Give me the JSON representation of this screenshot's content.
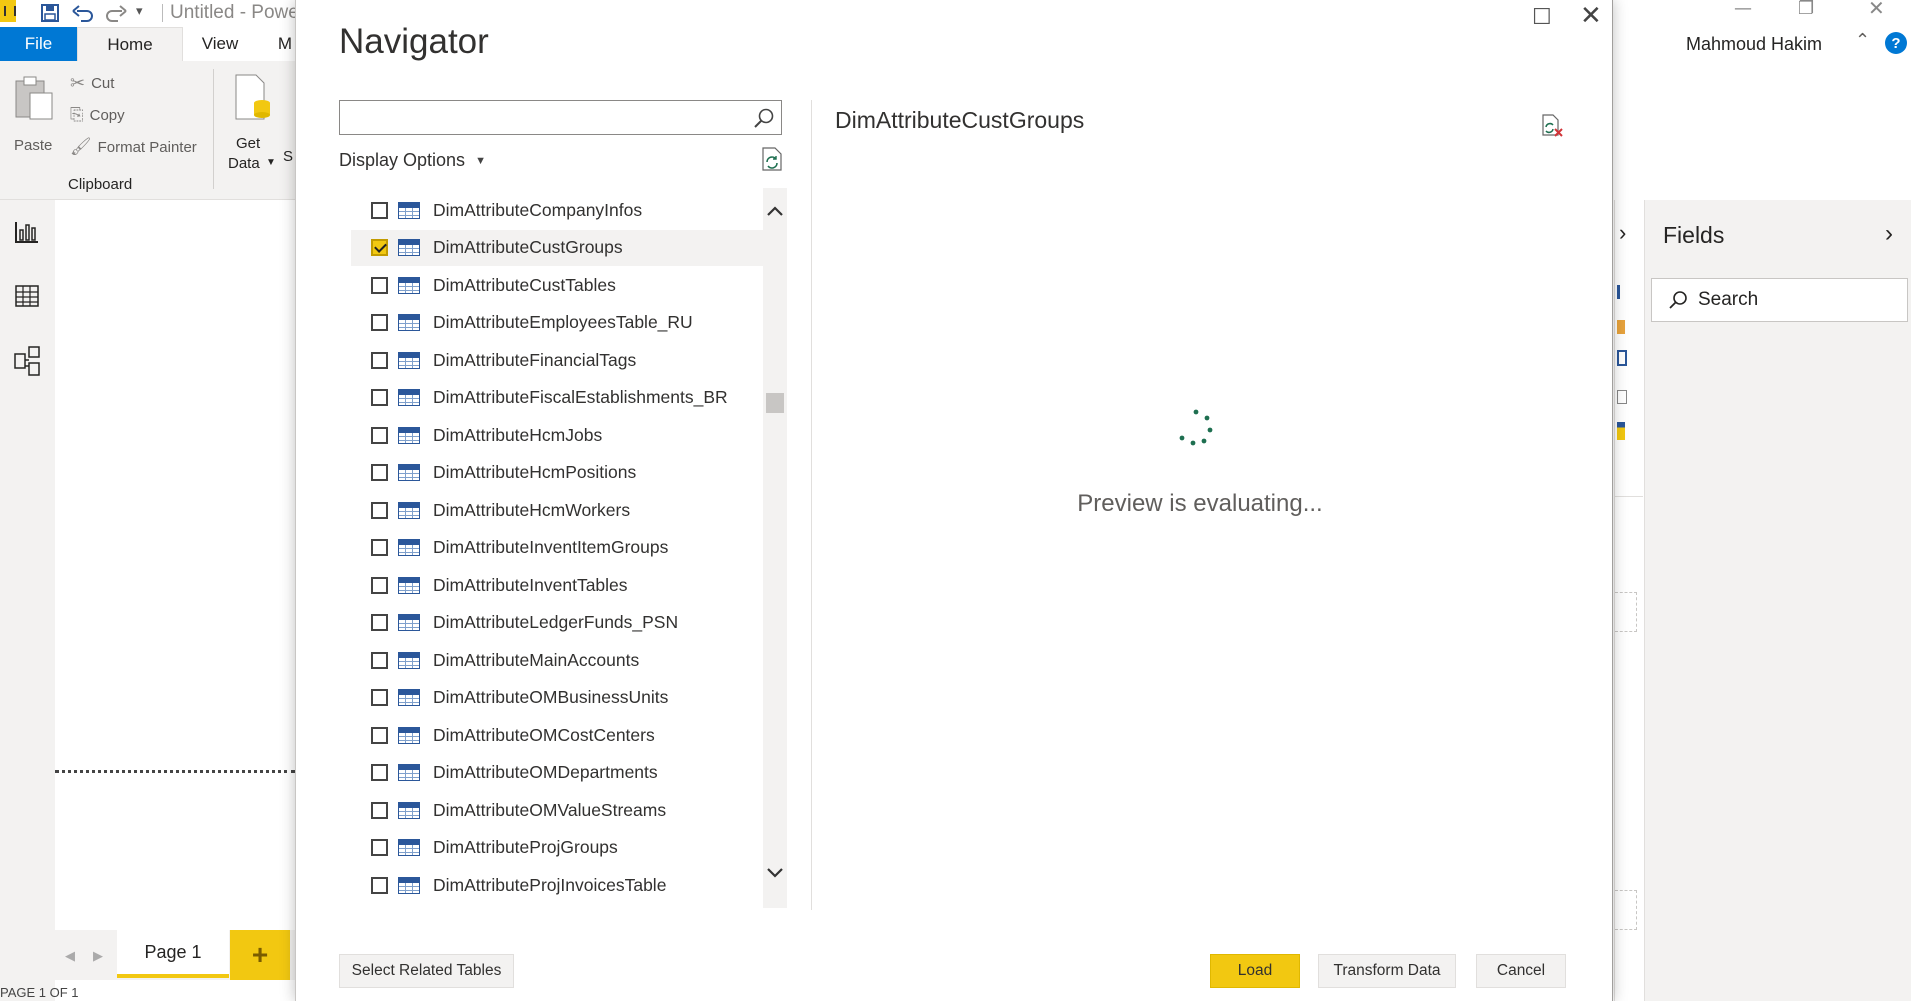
{
  "window": {
    "title": "Untitled - Powe",
    "user_name": "Mahmoud Hakim",
    "help_glyph": "?"
  },
  "ribbon": {
    "tabs": [
      {
        "label": "File"
      },
      {
        "label": "Home"
      },
      {
        "label": "View"
      },
      {
        "label": "M"
      }
    ],
    "clipboard": {
      "paste_label": "Paste",
      "cut_label": "Cut",
      "copy_label": "Copy",
      "format_painter_label": "Format Painter",
      "group_label": "Clipboard"
    },
    "get_data": {
      "line1": "Get",
      "line2": "Data",
      "overflow": "S"
    }
  },
  "pages": {
    "current_page_label": "Page 1",
    "add_glyph": "+",
    "status_text": "PAGE 1 OF 1"
  },
  "fields_pane": {
    "title": "Fields",
    "search_placeholder": "Search"
  },
  "navigator": {
    "title": "Navigator",
    "search_value": "",
    "display_options_label": "Display Options",
    "items": [
      {
        "label": "DimAttributeCompanyInfos",
        "checked": false
      },
      {
        "label": "DimAttributeCustGroups",
        "checked": true
      },
      {
        "label": "DimAttributeCustTables",
        "checked": false
      },
      {
        "label": "DimAttributeEmployeesTable_RU",
        "checked": false
      },
      {
        "label": "DimAttributeFinancialTags",
        "checked": false
      },
      {
        "label": "DimAttributeFiscalEstablishments_BR",
        "checked": false
      },
      {
        "label": "DimAttributeHcmJobs",
        "checked": false
      },
      {
        "label": "DimAttributeHcmPositions",
        "checked": false
      },
      {
        "label": "DimAttributeHcmWorkers",
        "checked": false
      },
      {
        "label": "DimAttributeInventItemGroups",
        "checked": false
      },
      {
        "label": "DimAttributeInventTables",
        "checked": false
      },
      {
        "label": "DimAttributeLedgerFunds_PSN",
        "checked": false
      },
      {
        "label": "DimAttributeMainAccounts",
        "checked": false
      },
      {
        "label": "DimAttributeOMBusinessUnits",
        "checked": false
      },
      {
        "label": "DimAttributeOMCostCenters",
        "checked": false
      },
      {
        "label": "DimAttributeOMDepartments",
        "checked": false
      },
      {
        "label": "DimAttributeOMValueStreams",
        "checked": false
      },
      {
        "label": "DimAttributeProjGroups",
        "checked": false
      },
      {
        "label": "DimAttributeProjInvoicesTable",
        "checked": false
      }
    ],
    "preview": {
      "title": "DimAttributeCustGroups",
      "status": "Preview is evaluating..."
    },
    "buttons": {
      "select_related": "Select Related Tables",
      "load": "Load",
      "transform": "Transform Data",
      "cancel": "Cancel"
    },
    "colors": {
      "accent_yellow": "#F2C811",
      "spinner_green": "#1E6F50",
      "table_icon_blue": "#2B579A"
    },
    "icons": [
      "search-icon",
      "refresh-icon",
      "table-icon",
      "checkbox",
      "chevron-up-icon",
      "chevron-down-icon",
      "spinner",
      "maximize-icon",
      "close-icon"
    ]
  }
}
